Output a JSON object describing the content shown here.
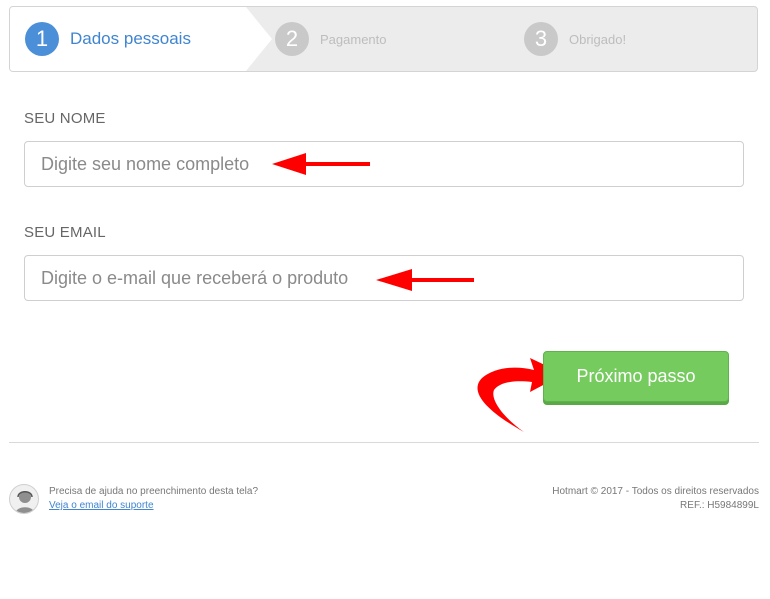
{
  "stepper": {
    "steps": [
      {
        "number": "1",
        "label": "Dados pessoais",
        "state": "active"
      },
      {
        "number": "2",
        "label": "Pagamento",
        "state": "inactive"
      },
      {
        "number": "3",
        "label": "Obrigado!",
        "state": "inactive"
      }
    ]
  },
  "form": {
    "name": {
      "label": "SEU NOME",
      "value": "",
      "placeholder": "Digite seu nome completo"
    },
    "email": {
      "label": "SEU EMAIL",
      "value": "",
      "placeholder": "Digite o e-mail que receberá o produto"
    },
    "next_label": "Próximo passo"
  },
  "annotations": {
    "arrow_color": "#ff0000"
  },
  "footer": {
    "help_text": "Precisa de ajuda no preenchimento desta tela?",
    "help_link": "Veja o email do suporte",
    "copyright": "Hotmart © 2017 - Todos os direitos reservados",
    "ref": "REF.: H5984899L"
  },
  "colors": {
    "accent_blue": "#4b8fd8",
    "button_green": "#76cb5f",
    "inactive_gray": "#c9c9c9"
  }
}
